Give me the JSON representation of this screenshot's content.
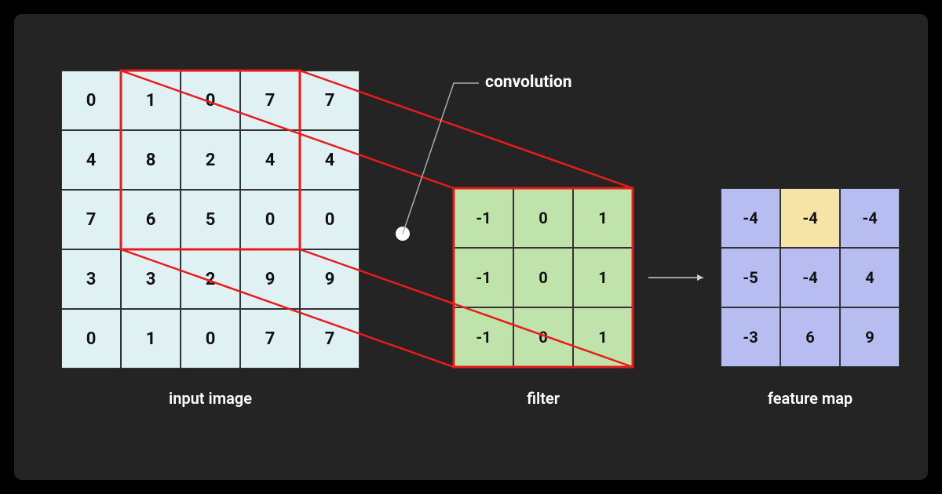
{
  "labels": {
    "input": "input image",
    "filter": "filter",
    "feature": "feature map",
    "convolution": "convolution"
  },
  "input_image": {
    "rows": 5,
    "cols": 5,
    "data": [
      [
        0,
        1,
        0,
        7,
        7
      ],
      [
        4,
        8,
        2,
        4,
        4
      ],
      [
        7,
        6,
        5,
        0,
        0
      ],
      [
        3,
        3,
        2,
        9,
        9
      ],
      [
        0,
        1,
        0,
        7,
        7
      ]
    ],
    "highlight_region": {
      "row_start": 0,
      "row_end": 2,
      "col_start": 1,
      "col_end": 3
    }
  },
  "filter": {
    "rows": 3,
    "cols": 3,
    "data": [
      [
        -1,
        0,
        1
      ],
      [
        -1,
        0,
        1
      ],
      [
        -1,
        0,
        1
      ]
    ]
  },
  "feature_map": {
    "rows": 3,
    "cols": 3,
    "data": [
      [
        -4,
        -4,
        -4
      ],
      [
        -5,
        -4,
        4
      ],
      [
        -3,
        6,
        9
      ]
    ],
    "highlight_cell": {
      "row": 0,
      "col": 1
    }
  },
  "colors": {
    "input_bg": "#e0f1f4",
    "filter_bg": "#bfe3aa",
    "feature_bg": "#b7bdf0",
    "highlight_bg": "#f6e4a6",
    "stroke": "#e81c1c"
  }
}
